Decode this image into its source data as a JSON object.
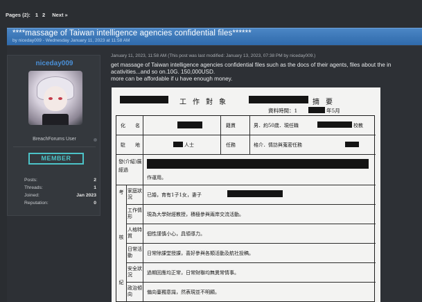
{
  "pager": {
    "label": "Pages (2):",
    "pages": [
      "1",
      "2"
    ],
    "next": "Next »"
  },
  "thread": {
    "title": "****massage of Taiwan intelligence agencies confidential files******",
    "meta": "by niceday009 - Wednesday January 11, 2023 at 11:58 AM"
  },
  "user": {
    "name": "niceday009",
    "title": "BreachForums User",
    "badge": "MEMBER",
    "stats": [
      {
        "label": "Posts:",
        "value": "2"
      },
      {
        "label": "Threads:",
        "value": "1"
      },
      {
        "label": "Joined:",
        "value": "Jan 2023"
      },
      {
        "label": "Reputation:",
        "value": "0"
      }
    ]
  },
  "post": {
    "meta": "January 11, 2023, 11:58 AM  (This post was last modified: January 13, 2023, 07:38 PM by niceday009.)",
    "lines": [
      "get massage of Taiwan intelligence agencies confidential files such as the docs of their agents, files about the in",
      "acativities...and so on.10G. 150,000USD.",
      "more can be affordable if u have enough money."
    ]
  },
  "document": {
    "title": "工作對象",
    "title_end": "摘要",
    "sub_label": "資料時間：1",
    "sub_month": "年5月",
    "rows": {
      "surname_label": "化名",
      "origin_label": "籍貫",
      "gender": "男．約50歲．現任職",
      "gender_tail": "校教",
      "address_label": "駐地",
      "address_tail": "人士",
      "duty_label": "任務",
      "duty": "格介．情訪與蒐密任務",
      "reporter_label": "發(介紹)展經過",
      "reporter_tail": "作運用。",
      "family_label": "家庭狀況",
      "family": "已婚，育有1子1女，妻子",
      "work_label": "工作情形",
      "work": "現為大學財經教授，積極參與兩岸交流活動。",
      "person_label": "人格特質",
      "person": "個性謹慎小心，具領導力。",
      "daily_label": "日常活動",
      "daily": "日常除課堂授課，喜好參與各類活動及航社投稿。",
      "safety_label": "安全狀況",
      "safety": "過期回應均正常，日常財聯均無異常情事。",
      "policy_label": "政治傾向",
      "policy": "偏向臺獨意識，然表現並不明顯。",
      "side_a": "考",
      "side_b": "核",
      "side_c": "紀"
    }
  }
}
